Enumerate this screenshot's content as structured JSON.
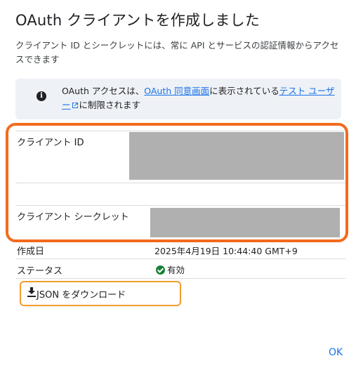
{
  "dialog": {
    "title": "OAuth クライアントを作成しました",
    "description": "クライアント ID とシークレットには、常に API とサービスの認証情報からアクセスできます"
  },
  "info": {
    "icon": "info-icon",
    "text_prefix": "OAuth アクセスは、",
    "link_consent": "OAuth 同意画面",
    "text_middle": "に表示されている",
    "link_test_users": "テスト ユーザー",
    "text_suffix": "に制限されます"
  },
  "fields": {
    "client_id_label": "クライアント ID",
    "client_secret_label": "クライアント シークレット"
  },
  "meta": {
    "created_label": "作成日",
    "created_value": "2025年4月19日 10:44:40 GMT+9",
    "status_label": "ステータス",
    "status_value": "有効"
  },
  "actions": {
    "download_label": "JSON をダウンロード",
    "ok_label": "OK"
  },
  "colors": {
    "accent": "#1a73e8",
    "highlight_main": "#f26b1d",
    "highlight_download": "#f29c2c",
    "status_ok": "#188038"
  }
}
